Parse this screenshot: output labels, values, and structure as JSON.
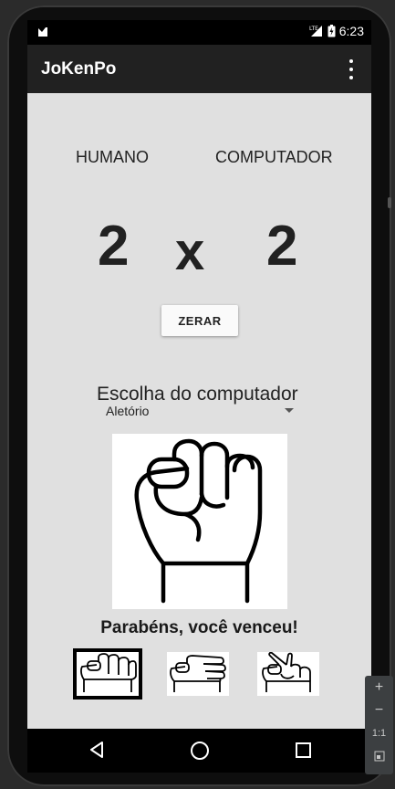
{
  "status_bar": {
    "network": "LTE",
    "time": "6:23"
  },
  "app_bar": {
    "title": "JoKenPo",
    "menu_icon": "overflow-menu-icon"
  },
  "scoreboard": {
    "human_label": "HUMANO",
    "computer_label": "COMPUTADOR",
    "human_score": "2",
    "separator": "x",
    "computer_score": "2"
  },
  "reset_button": {
    "label": "ZERAR"
  },
  "computer_choice": {
    "label": "Escolha do computador",
    "spinner_value": "Aletório",
    "image_icon": "rock-fist-icon"
  },
  "result_message": "Parabéns, você venceu!",
  "player_choices": [
    {
      "icon": "rock-icon",
      "selected": true
    },
    {
      "icon": "paper-icon",
      "selected": false
    },
    {
      "icon": "scissors-icon",
      "selected": false
    }
  ],
  "nav_bar": [
    "back-icon",
    "home-icon",
    "recents-icon"
  ],
  "emulator_toolbar": {
    "plus": "+",
    "minus": "−",
    "ratio": "1:1"
  }
}
